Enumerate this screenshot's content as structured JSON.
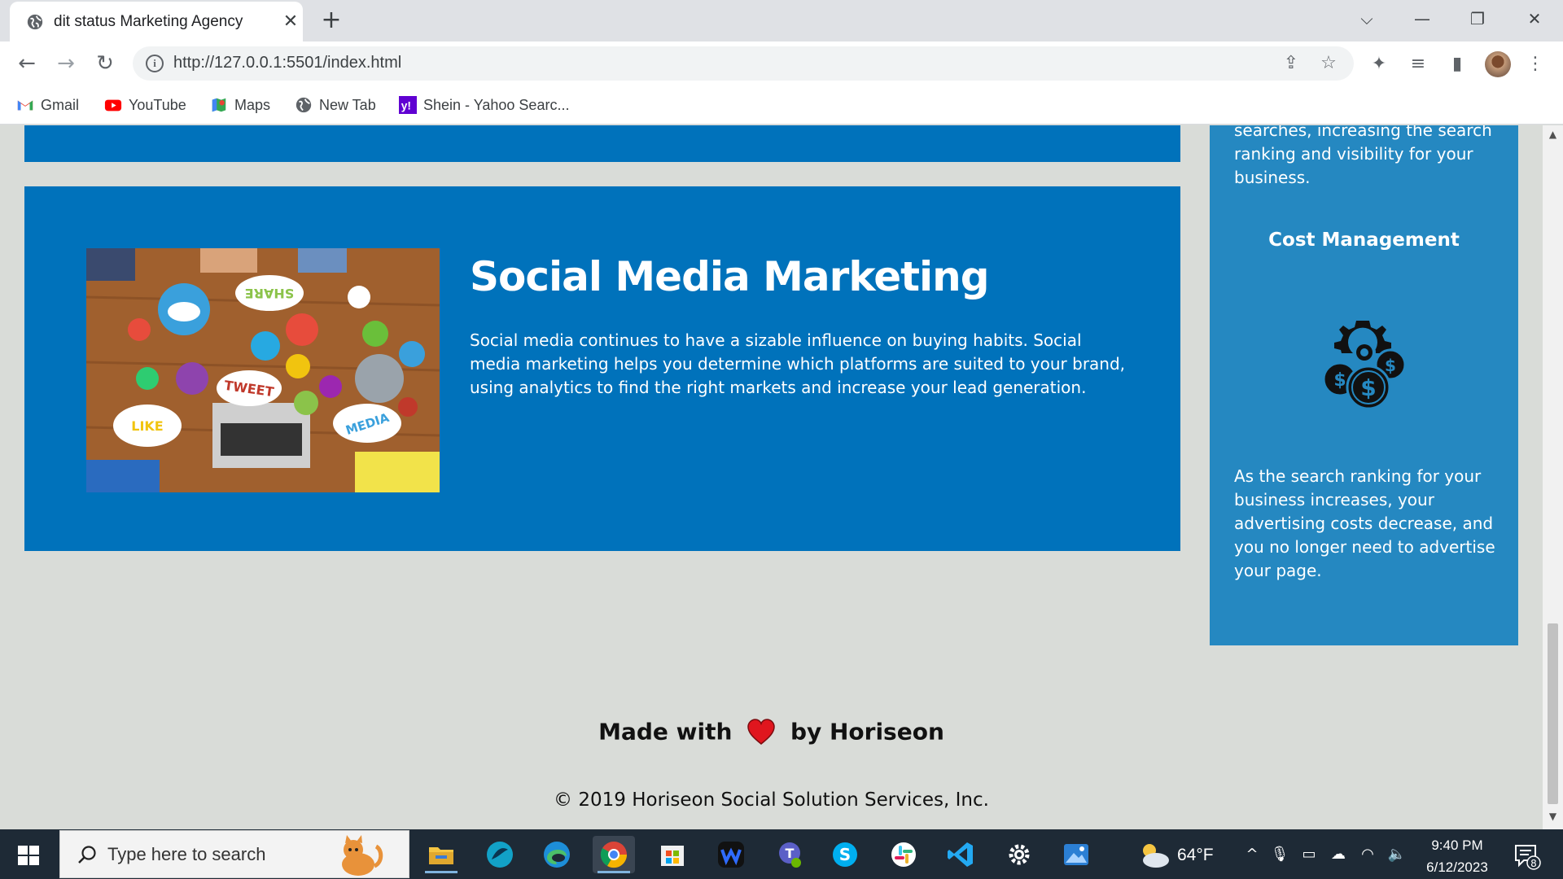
{
  "browser": {
    "tab_title": "dit status Marketing Agency",
    "url": "http://127.0.0.1:5501/index.html",
    "bookmarks": [
      "Gmail",
      "YouTube",
      "Maps",
      "New Tab",
      "Shein - Yahoo Searc..."
    ]
  },
  "page": {
    "sidebar_prev_text": "searches, increasing the search ranking and visibility for your business.",
    "social": {
      "title": "Social Media Marketing",
      "text": "Social media continues to have a sizable influence on buying habits. Social media marketing helps you determine which platforms are suited to your brand, using analytics to find the right markets and increase your lead generation.",
      "image_words": [
        "SHARE",
        "TWEET",
        "LIKE",
        "MEDIA"
      ]
    },
    "cost": {
      "title": "Cost Management",
      "text": "As the search ranking for your business increases, your advertising costs decrease, and you no longer need to advertise your page."
    },
    "footer": {
      "made_with": "Made with",
      "by": "by Horiseon",
      "copyright": "© 2019 Horiseon Social Solution Services, Inc."
    }
  },
  "taskbar": {
    "search_placeholder": "Type here to search",
    "temperature": "64°F",
    "time": "9:40 PM",
    "date": "6/12/2023",
    "notification_count": "8"
  },
  "colors": {
    "card_blue": "#0072bb",
    "sidebar_blue": "#2588c1",
    "page_bg": "#d9dcd8",
    "heart": "#e0161e"
  }
}
